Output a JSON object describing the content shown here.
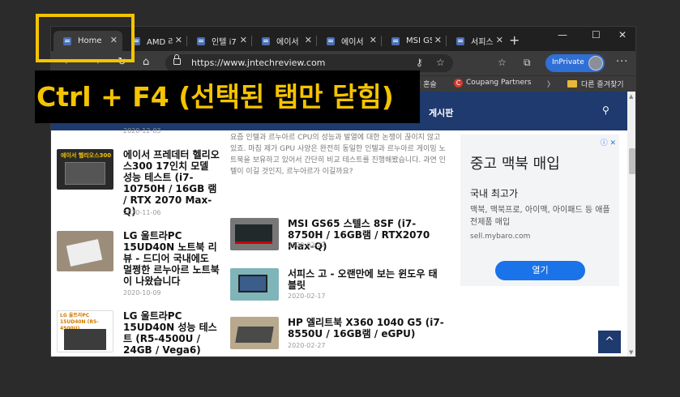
{
  "browser": {
    "tabs": [
      {
        "label": "Home"
      },
      {
        "label": "AMD 라"
      },
      {
        "label": "인텔 i7"
      },
      {
        "label": "에이서"
      },
      {
        "label": "에이서"
      },
      {
        "label": "MSI GS"
      },
      {
        "label": "서피스"
      }
    ],
    "new_tab": "+",
    "url": "https://www.jntechreview.com",
    "inprivate_label": "InPrivate",
    "favorites": {
      "item1": "의 혼슬",
      "item2": "Coupang Partners",
      "more": "〉",
      "other": "다른 즐겨찾기"
    }
  },
  "site": {
    "menu_label": "게시판",
    "top_date": "2020-12-03",
    "intro_text": "요즘 인텔과 르누아르 CPU의 성능과 발열에 대한 논쟁이 끊이지 않고 있죠. 마침 제가 GPU 사양은 완전히 동일한 인텔과 르누아르 게이밍 노트북을 보유하고 있어서 간단히 비교 테스트를 진행해봤습니다. 과연 인텔이 이길 것인지, 르누아르가 이길까요?",
    "left_posts": [
      {
        "title": "에이서 프레데터 헬리오스300 17인치 모델 성능 테스트 (i7-10750H / 16GB 램 / RTX 2070 Max-Q)",
        "date": "2020-11-06",
        "thumb_text": "에이서 헬리오스300"
      },
      {
        "title": "LG 울트라PC 15UD40N 노트북 리뷰 - 드디어 국내에도 멀쩡한 르누아르 노트북이 나왔습니다",
        "date": "2020-10-09",
        "thumb_text": ""
      },
      {
        "title": "LG 울트라PC 15UD40N 성능 테스트 (R5-4500U / 24GB / Vega6)",
        "date": "",
        "thumb_text": "LG 울트라PC 15UD40N (R5-4500U)"
      }
    ],
    "right_posts": [
      {
        "title": "MSI GS65 스텔스 8SF (i7-8750H / 16GB램 / RTX2070 Max-Q)",
        "date": "2020-02-27"
      },
      {
        "title": "서피스 고 - 오랜만에 보는 윈도우 태블릿",
        "date": "2020-02-17"
      },
      {
        "title": "HP 엘리트북 X360 1040 G5 (i7-8550U / 16GB램 / eGPU)",
        "date": "2020-02-27"
      }
    ],
    "to_top": "^"
  },
  "ad": {
    "badge": "ⓘ ✕",
    "headline": "중고 맥북 매입",
    "subhead": "국내 최고가",
    "body": "맥북, 맥북프로, 아이맥, 아이패드 등 애플 전제품 매입",
    "site": "sell.mybaro.com",
    "cta": "열기"
  },
  "overlay": {
    "caption": "Ctrl + F4 (선택된 탭만 닫힘)"
  },
  "colors": {
    "highlight": "#f5c400",
    "site_nav": "#1e3a6e",
    "inprivate": "#2f6fd6"
  }
}
